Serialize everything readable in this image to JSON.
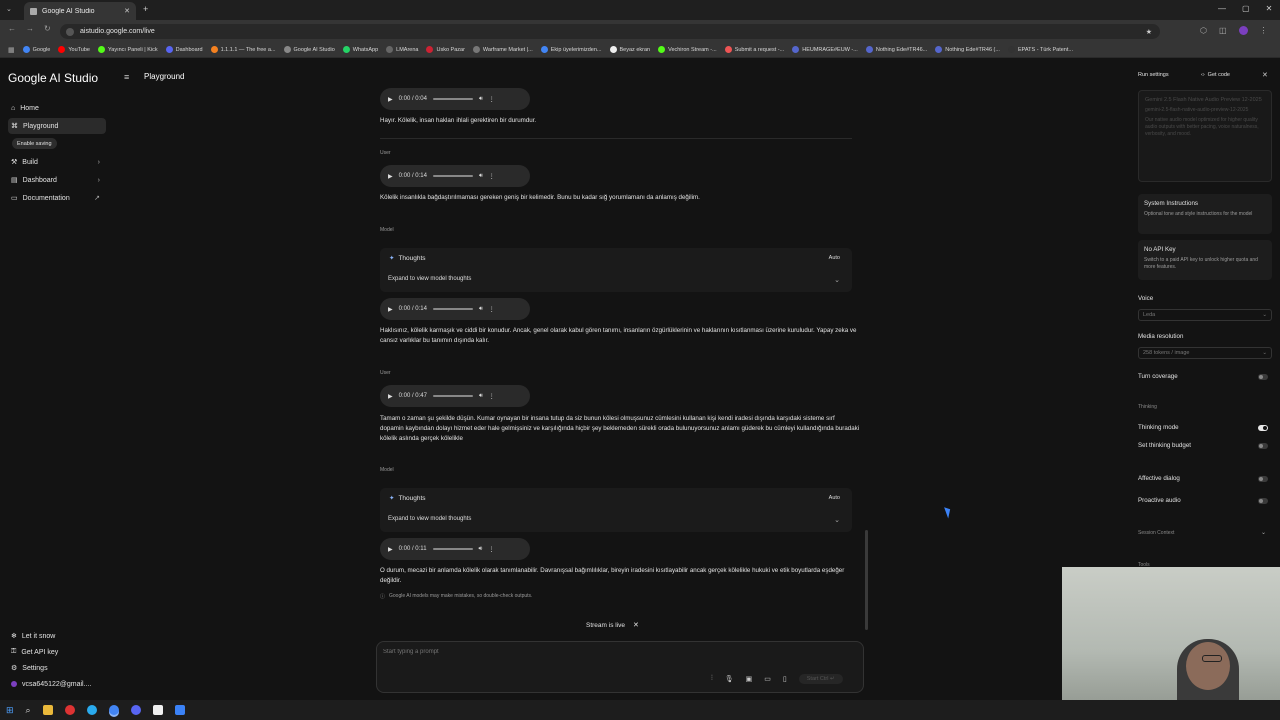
{
  "browser": {
    "tab_title": "Google AI Studio",
    "url": "aistudio.google.com/live",
    "bookmarks": [
      "Google",
      "YouTube",
      "Yayıncı Paneli | Kick",
      "Dashboard",
      "1.1.1.1 — The free a...",
      "Google AI Studio",
      "WhatsApp",
      "LMArena",
      "Usko Pazar",
      "Warframe Market |...",
      "Ekip üyelerimizden...",
      "Beyaz ekran",
      "Vechiron Stream -...",
      "Submit a request -...",
      "HEUMRAGE#EUW -...",
      "Nothing Ede#TR46...",
      "Nothing Ede#TR46 (...",
      "EPATS - Türk Patent..."
    ]
  },
  "sidebar": {
    "logo": "Google AI Studio",
    "items": [
      {
        "label": "Home"
      },
      {
        "label": "Playground"
      },
      {
        "label": "Build"
      },
      {
        "label": "Dashboard"
      },
      {
        "label": "Documentation"
      }
    ],
    "enable_saving": "Enable saving",
    "bottom": [
      {
        "label": "Let it snow"
      },
      {
        "label": "Get API key"
      },
      {
        "label": "Settings"
      },
      {
        "label": "vcsa645122@gmail...."
      }
    ]
  },
  "header": {
    "title": "Playground"
  },
  "chat": {
    "messages": [
      {
        "audio": "0:00 / 0:04",
        "text": "Hayır. Kölelik, insan hakları ihlali gerektiren bir durumdur."
      },
      {
        "role": "User",
        "audio": "0:00 / 0:14",
        "text": "Kölelik insanlıkla bağdaştırılmaması gereken geniş bir kelimedir. Bunu bu kadar sığ yorumlamanı da anlamış değilim."
      },
      {
        "role": "Model",
        "thoughts": "Thoughts",
        "auto": "Auto",
        "expand": "Expand to view model thoughts",
        "audio": "0:00 / 0:14",
        "text": "Haklısınız, kölelik karmaşık ve ciddi bir konudur. Ancak, genel olarak kabul gören tanımı, insanların özgürlüklerinin ve haklarının kısıtlanması üzerine kuruludur. Yapay zeka ve cansız varlıklar bu tanımın dışında kalır."
      },
      {
        "role": "User",
        "audio": "0:00 / 0:47",
        "text": "Tamam o zaman şu şekilde düşün. Kumar oynayan bir insana tutup da siz bunun kölesi olmuşsunuz cümlesini kullanan kişi kendi iradesi dışında karşıdaki sisteme sırf dopamin kaybından dolayı hizmet eder hale gelmişsiniz ve karşılığında hiçbir şey beklemeden sürekli orada bulunuyorsunuz anlamı güderek bu cümleyi kullandığında buradaki kölelik aslında gerçek kölelikle"
      },
      {
        "role": "Model",
        "thoughts": "Thoughts",
        "auto": "Auto",
        "expand": "Expand to view model thoughts",
        "audio": "0:00 / 0:11",
        "text": "O durum, mecazi bir anlamda kölelik olarak tanımlanabilir. Davranışsal bağımlılıklar, bireyin iradesini kısıtlayabilir ancak gerçek kölelikle hukuki ve etik boyutlarda eşdeğer değildir."
      }
    ],
    "disclaimer": "Google AI models may make mistakes, so double-check outputs.",
    "stream_status": "Stream is live",
    "prompt_placeholder": "Start typing a prompt",
    "run_label": "Start Ctrl ↵"
  },
  "right_panel": {
    "title": "Run settings",
    "get_code": "Get code",
    "model_lines": "Gemini 2.5 Flash Native Audio Preview 12-2025",
    "model_id": "gemini-2.5-flash-native-audio-preview-12-2025",
    "model_desc": "Our native audio model optimized for higher quality audio outputs with better pacing, voice naturalness, verbosity, and mood.",
    "system_title": "System Instructions",
    "system_desc": "Optional tone and style instructions for the model",
    "apikey_title": "No API Key",
    "apikey_desc": "Switch to a paid API key to unlock higher quota and more features.",
    "voice_label": "Voice",
    "voice_value": "Leda",
    "media_label": "Media resolution",
    "media_value": "258 tokens / image",
    "turn_coverage": "Turn coverage",
    "thinking_section": "Thinking",
    "thinking_mode": "Thinking mode",
    "thinking_budget": "Set thinking budget",
    "affective": "Affective dialog",
    "proactive": "Proactive audio",
    "session": "Session Context",
    "tools": "Tools"
  },
  "colors": {
    "accent": "#8ab4f8",
    "background": "#131313"
  }
}
